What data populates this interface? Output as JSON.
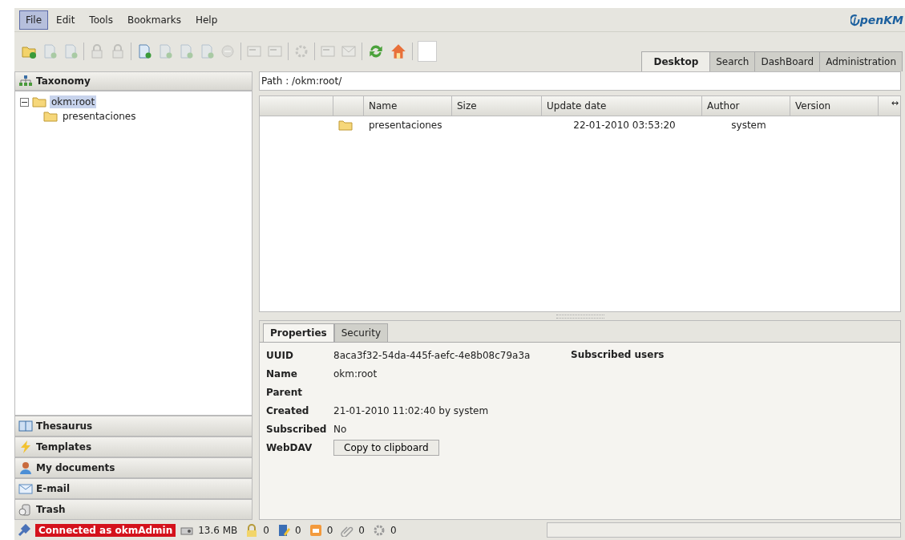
{
  "menu": [
    {
      "label": "File",
      "selected": true
    },
    {
      "label": "Edit",
      "selected": false
    },
    {
      "label": "Tools",
      "selected": false
    },
    {
      "label": "Bookmarks",
      "selected": false
    },
    {
      "label": "Help",
      "selected": false
    }
  ],
  "logo": {
    "text": "penKM"
  },
  "toolbar": [
    {
      "kind": "folder",
      "disabled": false
    },
    {
      "kind": "document",
      "disabled": true
    },
    {
      "kind": "document",
      "disabled": true
    },
    {
      "kind": "separator"
    },
    {
      "kind": "lock",
      "disabled": true
    },
    {
      "kind": "lock",
      "disabled": true
    },
    {
      "kind": "separator"
    },
    {
      "kind": "document",
      "disabled": false
    },
    {
      "kind": "document",
      "disabled": true
    },
    {
      "kind": "document",
      "disabled": true
    },
    {
      "kind": "document",
      "disabled": true
    },
    {
      "kind": "minus",
      "disabled": true
    },
    {
      "kind": "separator"
    },
    {
      "kind": "card",
      "disabled": true
    },
    {
      "kind": "card",
      "disabled": true
    },
    {
      "kind": "separator"
    },
    {
      "kind": "gear",
      "disabled": true
    },
    {
      "kind": "separator"
    },
    {
      "kind": "card",
      "disabled": true
    },
    {
      "kind": "mail",
      "disabled": true
    },
    {
      "kind": "separator"
    },
    {
      "kind": "refresh",
      "disabled": false
    },
    {
      "kind": "home",
      "disabled": false
    },
    {
      "kind": "separator"
    },
    {
      "kind": "blank",
      "disabled": false
    }
  ],
  "tabs": [
    {
      "label": "Desktop",
      "selected": true
    },
    {
      "label": "Search",
      "selected": false
    },
    {
      "label": "DashBoard",
      "selected": false
    },
    {
      "label": "Administration",
      "selected": false
    }
  ],
  "sidebar": {
    "title": "Taxonomy",
    "tree": [
      {
        "label": "okm:root",
        "expanded": true,
        "selected": true,
        "children": [
          {
            "label": "presentaciones",
            "selected": false
          }
        ]
      }
    ],
    "stack": [
      {
        "label": "Thesaurus",
        "kind": "book"
      },
      {
        "label": "Templates",
        "kind": "bolt"
      },
      {
        "label": "My documents",
        "kind": "person"
      },
      {
        "label": "E-mail",
        "kind": "mail"
      },
      {
        "label": "Trash",
        "kind": "trash"
      }
    ]
  },
  "path": {
    "label": "Path :",
    "value": "/okm:root/"
  },
  "table": {
    "columns": [
      "",
      "",
      "Name",
      "Size",
      "Update date",
      "Author",
      "Version"
    ],
    "resize_glyph": "↔",
    "rows": [
      {
        "kind": "folder",
        "name": "presentaciones",
        "size": "",
        "update_date": "22-01-2010 03:53:20",
        "author": "system",
        "version": ""
      }
    ]
  },
  "detail_tabs": [
    {
      "label": "Properties",
      "selected": true
    },
    {
      "label": "Security",
      "selected": false
    }
  ],
  "properties": [
    {
      "label": "UUID",
      "value": "8aca3f32-54da-445f-aefc-4e8b08c79a3a"
    },
    {
      "label": "Name",
      "value": "okm:root"
    },
    {
      "label": "Parent"
    },
    {
      "label": "Created",
      "value": "21-01-2010 11:02:40 by system"
    },
    {
      "label": "Subscribed",
      "value": "No"
    },
    {
      "label": "WebDAV",
      "button": "Copy to clipboard"
    }
  ],
  "subscribed_users": {
    "title": "Subscribed users"
  },
  "status_bar": {
    "connection": "Connected as okmAdmin",
    "size": "13.6 MB",
    "counters": [
      {
        "kind": "lock",
        "value": "0"
      },
      {
        "kind": "edit",
        "value": "0"
      },
      {
        "kind": "mail",
        "value": "0"
      },
      {
        "kind": "clip",
        "value": "0"
      },
      {
        "kind": "gear",
        "value": "0"
      }
    ]
  }
}
